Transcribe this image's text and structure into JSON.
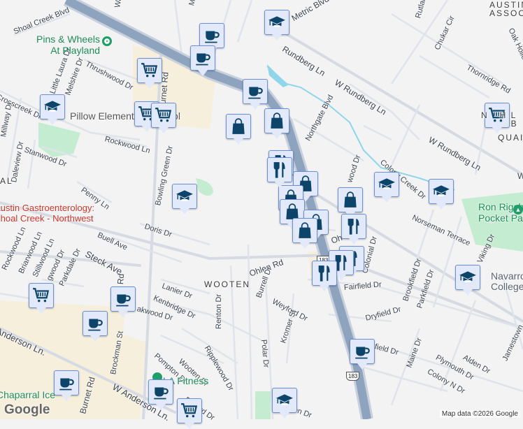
{
  "map": {
    "streets": {
      "shoal_creek": "Shoal Creek Blvd",
      "thrushwood": "Thrushwood Dr",
      "little_laura": "Little Laura Dr",
      "melshire": "Melshire Dr",
      "crosscreek": "Crosscreek Dr",
      "millway": "Millway Dr",
      "daleview": "Daleview Dr",
      "stanwood": "Stanwood Dr",
      "rockwood_ln": "Rockwood Ln",
      "burnet_top": "Burnet Rd",
      "bowling_green": "Bowling Green Dr",
      "penny": "Penny Ln",
      "doris": "Doris Dr",
      "buell": "Buell Ave",
      "steck": "Steck Ave",
      "rockwood_ln2": "Rockwood Ln",
      "briarwood": "Briarwood Ln",
      "stillwood": "Stillwood Ln",
      "ridgewood": "gwood Dr",
      "parkdale": "Parkdale Dr",
      "burnet_mid": "Rd",
      "lanier": "Lanier Dr",
      "kenbridge": "Kenbridge Dr",
      "oakwood": "akwood Dr",
      "anderson": "Anderson Ln.",
      "w_anderson": "W Anderson Ln.",
      "burnet_bottom": "Burnet Rd",
      "brockman": "Brockman St",
      "pompton": "Pompton Dr",
      "wooten_dr": "Wooten Dr",
      "ripplewood": "Ripplewood Dr",
      "renton": "Renton Dr",
      "belford": "Belford Dr",
      "ohlen": "Ohlen Rd",
      "ohlen2": "Oh",
      "burrell": "Burrell Dr",
      "weyford": "Weyford Dr",
      "kromer": "Kromer St",
      "polar": "Polar Dr",
      "metric": "Metric Blvd",
      "rundberg1": "Rundberg Ln",
      "rundberg2": "W Rundberg Ln",
      "rundberg3": "W Rundberg Ln",
      "rundberg4": "W",
      "northgate": "Northgate Blvd",
      "rutland": "Rutland",
      "chukar": "Chukar Cir",
      "thornridge": "Thornridge Rd",
      "oak_hollow": "Oak Hollow",
      "colony_creek": "Colony Creek Dr",
      "norwood": "wood Dr",
      "norseman": "Norseman Terrace",
      "colonial": "Colonial Dr",
      "fairfield": "Fairfield Dr",
      "dryfield": "Dryfield Dr",
      "brookfield": "Brookfield Dr",
      "parkfield": "Parkfield Dr",
      "viking": "Viking Dr",
      "fairfield2": "field Dr",
      "maine": "Maine Dr",
      "plymouth": "Plymouth Dr",
      "alden": "Alden Dr",
      "colony_n": "Colony N Dr",
      "jamestown": "Jamestown",
      "glen": "en Dr",
      "wa": "Wa",
      "m": "M"
    },
    "areas": {
      "wooten": "WOOTEN",
      "austin_assoc_1": "AUSTIN",
      "austin_assoc_2": "ASSOC",
      "north_l": "N   H L",
      "dbl": "DB",
      "quai": "QUAI",
      "al": "AL"
    },
    "pois": {
      "pins_wheels": "Pins & Wheels\nAt Playland",
      "pillow": "Pillow Elementary School",
      "gastro": "Austin Gastroenterology:\nShoal Creek - Northwest",
      "ron_rigsby": "Ron Rigsby\nPocket Park",
      "navarro": "Navarro\nCollege",
      "la_fitness": "LA Fitness",
      "chaparral": "Chaparral Ice"
    },
    "highway_shield": "183",
    "attribution": "Map data ©2026 Google",
    "logo": "Google",
    "colors": {
      "marker_bg": "#e1e9fb",
      "marker_border": "#6d8fd8",
      "marker_icon": "#0d4469",
      "highway": "#8ea3bd",
      "park": "#c3ecd0",
      "commercial": "#f6efdc",
      "water": "#8fd6ea"
    }
  }
}
